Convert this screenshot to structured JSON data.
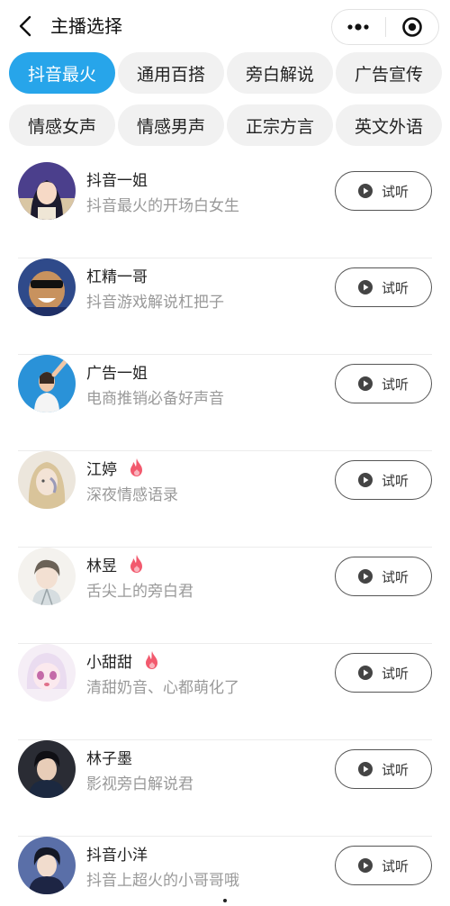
{
  "header": {
    "title": "主播选择"
  },
  "tabs": [
    {
      "label": "抖音最火",
      "active": true
    },
    {
      "label": "通用百搭",
      "active": false
    },
    {
      "label": "旁白解说",
      "active": false
    },
    {
      "label": "广告宣传",
      "active": false
    },
    {
      "label": "情感女声",
      "active": false
    },
    {
      "label": "情感男声",
      "active": false
    },
    {
      "label": "正宗方言",
      "active": false
    },
    {
      "label": "英文外语",
      "active": false
    }
  ],
  "anchors": [
    {
      "name": "抖音一姐",
      "desc": "抖音最火的开场白女生",
      "hot": false,
      "button": "试听"
    },
    {
      "name": "杠精一哥",
      "desc": "抖音游戏解说杠把子",
      "hot": false,
      "button": "试听"
    },
    {
      "name": "广告一姐",
      "desc": "电商推销必备好声音",
      "hot": false,
      "button": "试听"
    },
    {
      "name": "江婷",
      "desc": "深夜情感语录",
      "hot": true,
      "button": "试听"
    },
    {
      "name": "林昱",
      "desc": "舌尖上的旁白君",
      "hot": true,
      "button": "试听"
    },
    {
      "name": "小甜甜",
      "desc": "清甜奶音、心都萌化了",
      "hot": true,
      "button": "试听"
    },
    {
      "name": "林子墨",
      "desc": "影视旁白解说君",
      "hot": false,
      "button": "试听"
    },
    {
      "name": "抖音小洋",
      "desc": "抖音上超火的小哥哥哦",
      "hot": false,
      "button": "试听"
    }
  ],
  "colors": {
    "accent": "#27a5ea",
    "hot": "#f25a6e"
  }
}
